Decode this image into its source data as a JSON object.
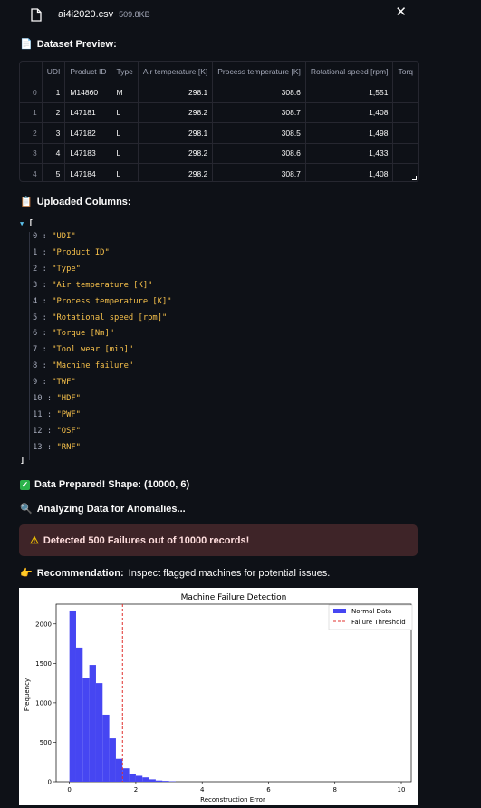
{
  "file": {
    "name": "ai4i2020.csv",
    "size": "509.8KB",
    "close_icon": "close-icon"
  },
  "sections": {
    "preview_title": "Dataset Preview:",
    "columns_title": "Uploaded Columns:",
    "prepared": "Data Prepared! Shape: (10000, 6)",
    "analyzing": "Analyzing Data for Anomalies...",
    "alert": "Detected 500 Failures out of 10000 records!",
    "recommendation_label": "Recommendation:",
    "recommendation_text": "Inspect flagged machines for potential issues."
  },
  "table": {
    "headers": [
      "UDI",
      "Product ID",
      "Type",
      "Air temperature [K]",
      "Process temperature [K]",
      "Rotational speed [rpm]",
      "Torq"
    ],
    "rows": [
      [
        "0",
        "1",
        "M14860",
        "M",
        "298.1",
        "308.6",
        "1,551"
      ],
      [
        "1",
        "2",
        "L47181",
        "L",
        "298.2",
        "308.7",
        "1,408"
      ],
      [
        "2",
        "3",
        "L47182",
        "L",
        "298.1",
        "308.5",
        "1,498"
      ],
      [
        "3",
        "4",
        "L47183",
        "L",
        "298.2",
        "308.6",
        "1,433"
      ],
      [
        "4",
        "5",
        "L47184",
        "L",
        "298.2",
        "308.7",
        "1,408"
      ]
    ]
  },
  "json_view": {
    "open": "[",
    "close": "]",
    "items": [
      {
        "key": "0",
        "value": "\"UDI\""
      },
      {
        "key": "1",
        "value": "\"Product ID\""
      },
      {
        "key": "2",
        "value": "\"Type\""
      },
      {
        "key": "3",
        "value": "\"Air temperature [K]\""
      },
      {
        "key": "4",
        "value": "\"Process temperature [K]\""
      },
      {
        "key": "5",
        "value": "\"Rotational speed [rpm]\""
      },
      {
        "key": "6",
        "value": "\"Torque [Nm]\""
      },
      {
        "key": "7",
        "value": "\"Tool wear [min]\""
      },
      {
        "key": "8",
        "value": "\"Machine failure\""
      },
      {
        "key": "9",
        "value": "\"TWF\""
      },
      {
        "key": "10",
        "value": "\"HDF\""
      },
      {
        "key": "11",
        "value": "\"PWF\""
      },
      {
        "key": "12",
        "value": "\"OSF\""
      },
      {
        "key": "13",
        "value": "\"RNF\""
      }
    ]
  },
  "colors": {
    "background": "#0e1117",
    "alert_bg": "#3e2428",
    "json_value": "#f7c14b",
    "bar": "#4646f2",
    "threshold": "#e0302e"
  },
  "chart_data": {
    "type": "bar",
    "title": "Machine Failure Detection",
    "xlabel": "Reconstruction Error",
    "ylabel": "Frequency",
    "xlim": [
      -0.4,
      10.3
    ],
    "ylim": [
      0,
      2250
    ],
    "xticks": [
      0,
      2,
      4,
      6,
      8,
      10
    ],
    "yticks": [
      0,
      500,
      1000,
      1500,
      2000
    ],
    "bin_width": 0.2,
    "bin_starts": [
      0.0,
      0.2,
      0.4,
      0.6,
      0.8,
      1.0,
      1.2,
      1.4,
      1.6,
      1.8,
      2.0,
      2.2,
      2.4,
      2.6,
      2.8,
      3.0
    ],
    "values": [
      2170,
      1700,
      1320,
      1480,
      1250,
      850,
      550,
      290,
      170,
      100,
      75,
      55,
      30,
      15,
      10,
      5
    ],
    "threshold": 1.6,
    "legend": [
      "Normal Data",
      "Failure Threshold"
    ],
    "legend_position": "top-right"
  }
}
